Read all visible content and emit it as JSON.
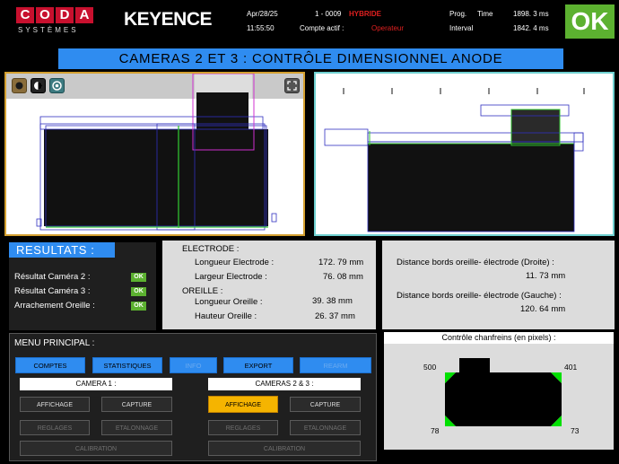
{
  "header": {
    "logo_letters": [
      "C",
      "O",
      "D",
      "A"
    ],
    "logo_sub": "SYSTÈMES",
    "keyence": "KEYENCE",
    "date": "Apr/28/25",
    "time": "11:55:50",
    "count": "1 - 0009",
    "mode": "HYBRIDE",
    "account_label": "Compte actif :",
    "account_value": "Operateur",
    "prog_label": "Prog.",
    "time_label": "Time",
    "time_value": "1898. 3 ms",
    "interval_label": "Interval",
    "interval_value": "1842. 4 ms",
    "status": "OK"
  },
  "title": "CAMERAS 2 ET 3 : CONTRÔLE DIMENSIONNEL ANODE",
  "results": {
    "title": "RESULTATS :",
    "items": [
      {
        "label": "Résultat Caméra 2 :",
        "status": "OK"
      },
      {
        "label": "Résultat Caméra 3 :",
        "status": "OK"
      },
      {
        "label": "Arrachement Oreille :",
        "status": "OK"
      }
    ]
  },
  "measurements": {
    "electrode_title": "ELECTRODE :",
    "longueur_electrode_label": "Longueur Electrode :",
    "longueur_electrode_value": "172. 79  mm",
    "largeur_electrode_label": "Largeur Electrode :",
    "largeur_electrode_value": "76. 08  mm",
    "oreille_title": "OREILLE :",
    "longueur_oreille_label": "Longueur Oreille :",
    "longueur_oreille_value": "39. 38  mm",
    "hauteur_oreille_label": "Hauteur Oreille :",
    "hauteur_oreille_value": "26. 37  mm"
  },
  "distances": {
    "droite_label": "Distance bords oreille- électrode (Droite) :",
    "droite_value": "11. 73  mm",
    "gauche_label": "Distance bords oreille- électrode (Gauche) :",
    "gauche_value": "120. 64  mm"
  },
  "menu": {
    "title": "MENU PRINCIPAL :",
    "top_buttons": [
      "COMPTES",
      "STATISTIQUES",
      "INFO",
      "EXPORT",
      "REARM"
    ],
    "camera1_label": "CAMERA 1 :",
    "cameras23_label": "CAMERAS 2 & 3 :",
    "affichage": "AFFICHAGE",
    "capture": "CAPTURE",
    "reglages": "REGLAGES",
    "etalonnage": "ETALONNAGE",
    "calibration": "CALIBRATION"
  },
  "chanfreins": {
    "title": "Contrôle chanfreins (en pixels) :",
    "top_left": "500",
    "top_right": "401",
    "bottom_left": "78",
    "bottom_right": "73"
  },
  "colors": {
    "accent_blue": "#2f8cf0",
    "ok_green": "#5cb130",
    "alert_red": "#e02020",
    "selected_yellow": "#f5b400"
  }
}
